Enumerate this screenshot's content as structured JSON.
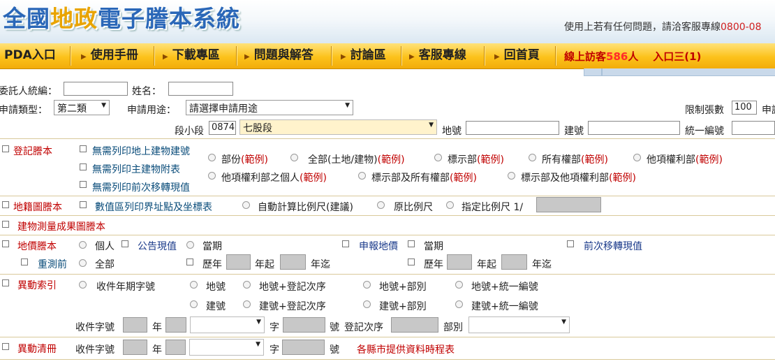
{
  "header": {
    "logo": [
      "全國",
      "地政",
      "電子謄本系統"
    ],
    "contact_text": "使用上若有任何問題，請洽客服專線",
    "contact_phone": "0800-08"
  },
  "nav": {
    "items": [
      "PDA入口",
      "使用手冊",
      "下載專區",
      "問題與解答",
      "討論區",
      "客服專線",
      "回首頁"
    ],
    "online_prefix": "線上訪客",
    "online_count": "586",
    "online_suffix": "人",
    "entry": "入口三(1)"
  },
  "form": {
    "client_id_label": "委託人統編：",
    "name_label": "姓名：",
    "apply_type_label": "申請類型：",
    "apply_type_value": "第二類",
    "purpose_label": "申請用途：",
    "purpose_value": "請選擇申請用途",
    "limit_label": "限制張數",
    "limit_value": "100",
    "limit_suffix": "申請",
    "section_label": "段小段",
    "section_code": "0874",
    "section_name": "七股段",
    "lot_label": "地號",
    "building_label": "建號",
    "unified_label": "統一編號"
  },
  "reg": {
    "title": "登記謄本",
    "no_print_1": "無需列印地上建物建號",
    "no_print_2": "無需列印主建物附表",
    "no_print_3": "無需列印前次移轉現值",
    "opt_partial": "部份",
    "opt_all": "全部(土地/建物)",
    "opt_mark": "標示部",
    "opt_owner": "所有權部",
    "opt_other": "他項權利部",
    "opt_other_person": "他項權利部之個人",
    "opt_mark_owner": "標示部及所有權部",
    "opt_mark_other": "標示部及他項權利部",
    "sample": "(範例)"
  },
  "cadastral": {
    "title": "地籍圖謄本",
    "numeric": "數值區列印界址點及坐標表",
    "auto_scale": "自動計算比例尺(建議)",
    "original_scale": "原比例尺",
    "specified_scale": "指定比例尺 1/"
  },
  "building_survey": {
    "title": "建物測量成果圖謄本"
  },
  "land_value": {
    "title": "地價謄本",
    "personal": "個人",
    "announced": "公告現值",
    "current_1": "當期",
    "declared": "申報地價",
    "current_2": "當期",
    "prev_transfer": "前次移轉現值",
    "remeasure": "重測前",
    "all": "全部",
    "history_1": "歷年",
    "year_from_1": "年起",
    "year_to_1": "年迄",
    "history_2": "歷年",
    "year_from_2": "年起",
    "year_to_2": "年迄"
  },
  "change_index": {
    "title": "異動索引",
    "receipt_year": "收件年期字號",
    "lot": "地號",
    "lot_reg": "地號+登記次序",
    "lot_part": "地號+部別",
    "lot_unified": "地號+統一編號",
    "bld": "建號",
    "bld_reg": "建號+登記次序",
    "bld_part": "建號+部別",
    "bld_unified": "建號+統一編號",
    "receipt_no": "收件字號",
    "year": "年",
    "char": "字",
    "number": "號",
    "reg_order": "登記次序",
    "part": "部別"
  },
  "change_detail": {
    "title": "異動清冊",
    "receipt_no": "收件字號",
    "year": "年",
    "char": "字",
    "number": "號",
    "schedule_link": "各縣市提供資料時程表"
  },
  "colors": {
    "nav": "#fcc21b",
    "accent_red": "#c00000",
    "logo_blue": "#2a67b8",
    "logo_gold": "#e9a400"
  }
}
